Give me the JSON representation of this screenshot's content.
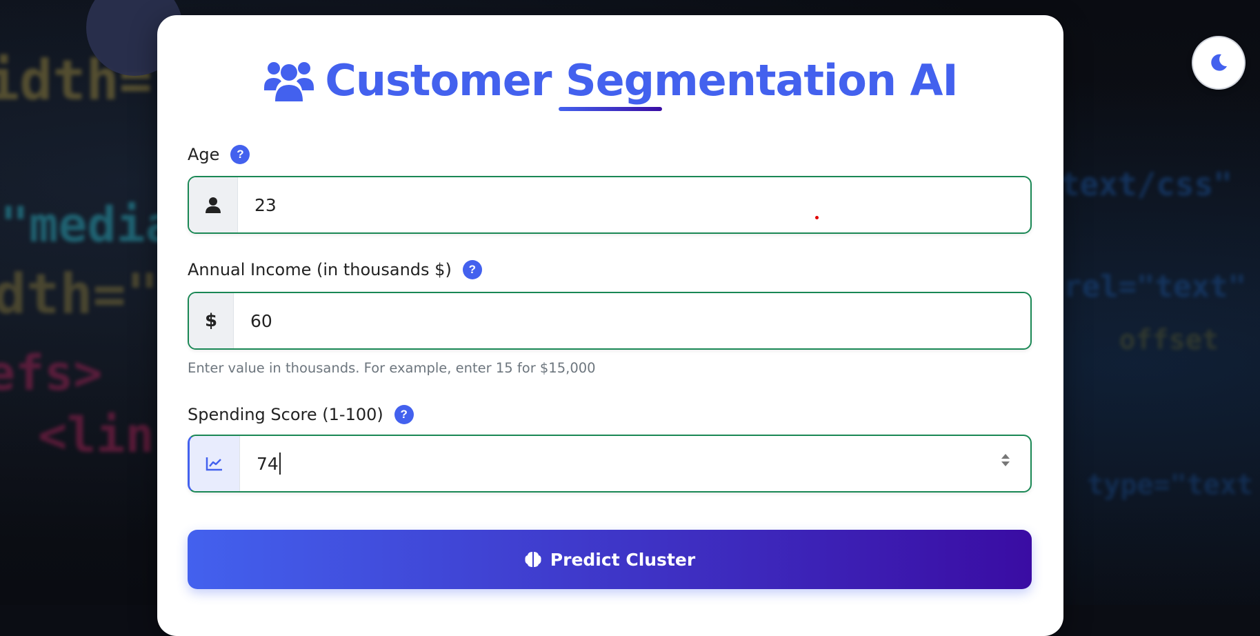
{
  "background_code": {
    "line1": "idth=\"",
    "line2": "\"media",
    "line3": "dth=\"",
    "line4": "efs>",
    "line5": "<lin",
    "line6": "\"text/css\"",
    "line7": "rel=\"text\"",
    "line8": "offset",
    "line9": "type=\"text"
  },
  "header": {
    "title": "Customer Segmentation AI",
    "icon": "users-icon"
  },
  "form": {
    "age": {
      "label": "Age",
      "help": "?",
      "icon": "user-icon",
      "value": "23"
    },
    "income": {
      "label": "Annual Income (in thousands $)",
      "help": "?",
      "icon": "dollar-icon",
      "addon_text": "$",
      "value": "60",
      "help_text": "Enter value in thousands. For example, enter 15 for $15,000"
    },
    "spending": {
      "label": "Spending Score (1-100)",
      "help": "?",
      "icon": "chart-line-icon",
      "value": "74"
    }
  },
  "actions": {
    "predict_label": "Predict Cluster",
    "predict_icon": "brain-icon"
  },
  "theme_toggle": {
    "icon": "moon-icon"
  },
  "colors": {
    "primary": "#4361ee",
    "secondary": "#3a0ca3",
    "valid": "#198754"
  }
}
